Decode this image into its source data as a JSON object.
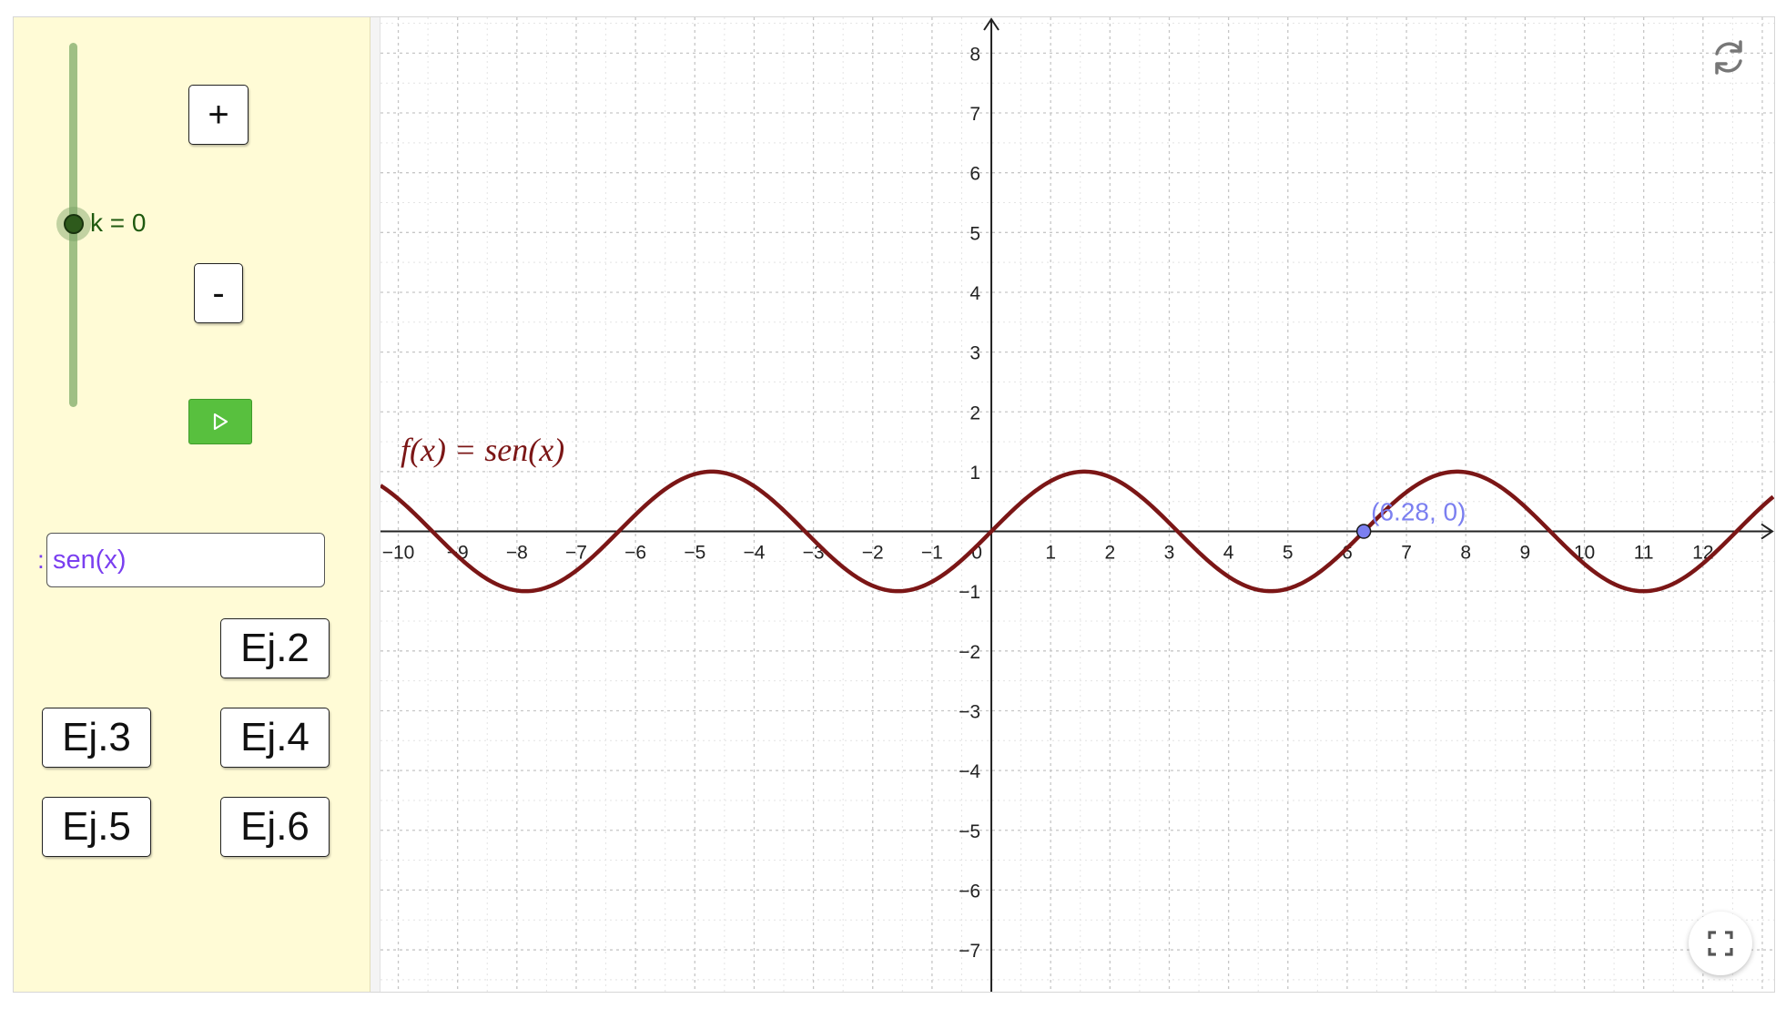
{
  "left_panel": {
    "slider": {
      "name": "k",
      "value": 0,
      "label": "k = 0",
      "color": "#2e5a1c"
    },
    "plus_label": "+",
    "minus_label": "-",
    "play_icon": "play-icon",
    "input_prefix": ":",
    "function_input": {
      "value": "sen(x)"
    },
    "buttons": {
      "ej2": "Ej.2",
      "ej3": "Ej.3",
      "ej4": "Ej.4",
      "ej5": "Ej.5",
      "ej6": "Ej.6"
    }
  },
  "graph": {
    "function_label": "f(x)  =  sen(x)",
    "point_label": "(6.28, 0)",
    "curve_color": "#7b1616",
    "point_color": "#7b7ff0"
  },
  "chart_data": {
    "type": "line",
    "series": [
      {
        "function": "sin(x)",
        "color": "#7b1616"
      }
    ],
    "points": [
      {
        "x": 6.28,
        "y": 0,
        "label": "(6.28, 0)"
      }
    ],
    "xlim": [
      -10.3,
      13.2
    ],
    "ylim": [
      -7.7,
      8.6
    ],
    "x_ticks": [
      -10,
      -9,
      -8,
      -7,
      -6,
      -5,
      -4,
      -3,
      -2,
      -1,
      0,
      1,
      2,
      3,
      4,
      5,
      6,
      7,
      8,
      9,
      10,
      11,
      12
    ],
    "y_ticks": [
      -7,
      -6,
      -5,
      -4,
      -3,
      -2,
      -1,
      1,
      2,
      3,
      4,
      5,
      6,
      7,
      8
    ],
    "grid": true,
    "minor_grid": true
  },
  "icons": {
    "refresh": "refresh-icon",
    "fullscreen": "fullscreen-icon"
  }
}
